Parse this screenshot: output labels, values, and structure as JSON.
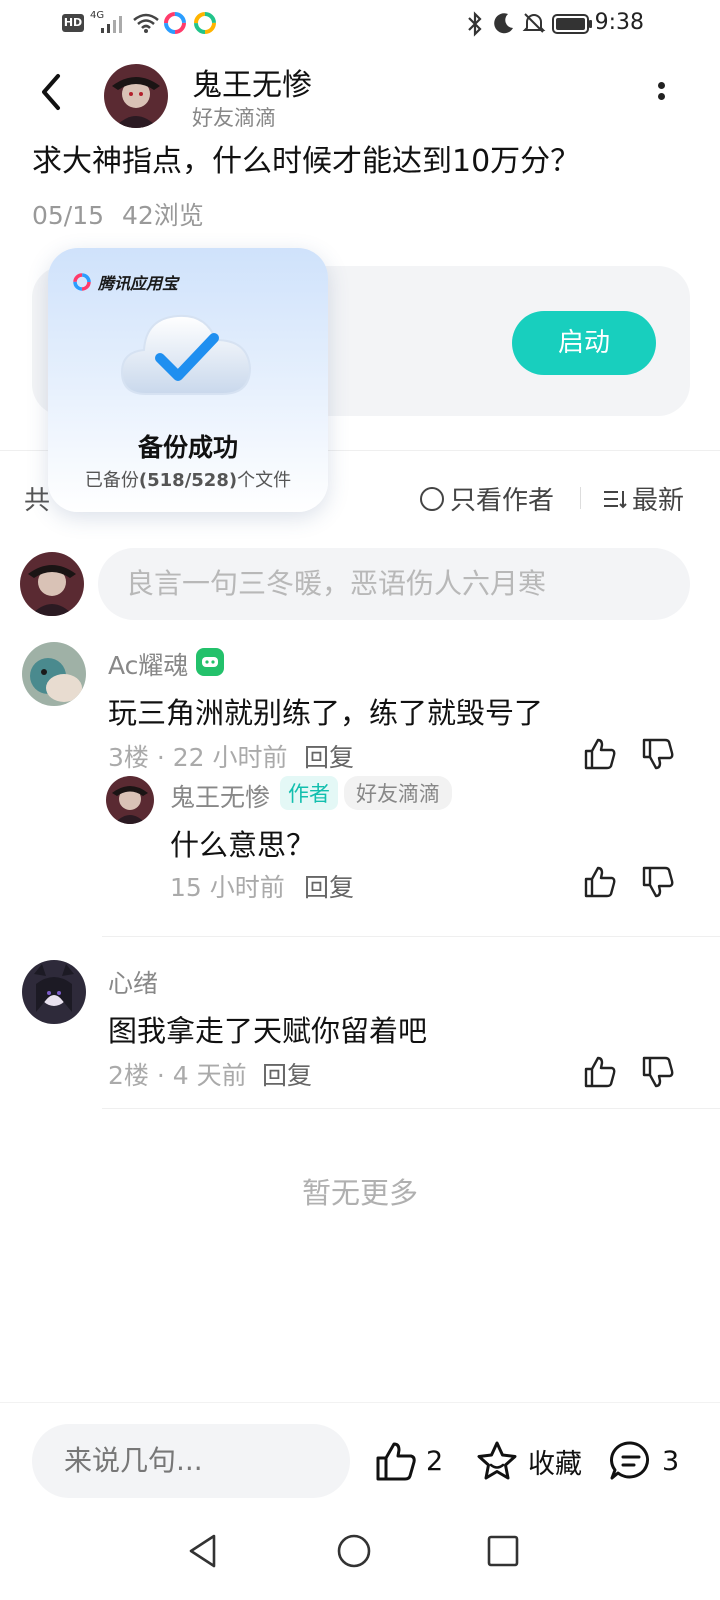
{
  "status_bar": {
    "hd_label": "HD",
    "network_label": "4G",
    "time": "9:38",
    "icons": [
      "signal-icon",
      "wifi-icon",
      "app-tray-icon",
      "bluetooth-icon",
      "moon-icon",
      "mute-icon",
      "battery-icon"
    ]
  },
  "header": {
    "user_name": "鬼王无惨",
    "user_tag": "好友滴滴"
  },
  "post": {
    "title": "求大神指点，什么时候才能达到10万分？",
    "date": "05/15",
    "views": "42浏览"
  },
  "game_card": {
    "launch_label": "启动"
  },
  "popup": {
    "brand": "腾讯应用宝",
    "title": "备份成功",
    "subtitle_prefix": "已备份",
    "subtitle_count": "(518/528)",
    "subtitle_suffix": "个文件"
  },
  "filters": {
    "count_label": "共",
    "only_author": "只看作者",
    "sort_latest": "最新"
  },
  "comment_input": {
    "placeholder": "良言一句三冬暖，恶语伤人六月寒"
  },
  "comments": [
    {
      "user": "Ac耀魂",
      "text": "玩三角洲就别练了，练了就毁号了",
      "floor": "3楼",
      "time": "22 小时前",
      "reply_label": "回复",
      "replies": [
        {
          "user": "鬼王无惨",
          "author_badge": "作者",
          "tag": "好友滴滴",
          "text": "什么意思？",
          "time": "15 小时前",
          "reply_label": "回复"
        }
      ]
    },
    {
      "user": "心绪",
      "text": "图我拿走了天赋你留着吧",
      "floor": "2楼",
      "time": "4 天前",
      "reply_label": "回复",
      "replies": []
    }
  ],
  "list_end": "暂无更多",
  "bottom_bar": {
    "input_placeholder": "来说几句...",
    "like_count": "2",
    "favorite_label": "收藏",
    "comment_count": "3"
  },
  "colors": {
    "accent": "#18cfbe",
    "text_primary": "#111111",
    "text_secondary": "#888888",
    "input_bg": "#f3f4f6"
  }
}
